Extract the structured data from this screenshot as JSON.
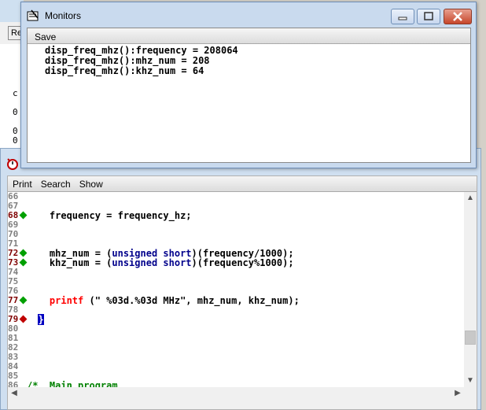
{
  "monitors": {
    "title": "Monitors",
    "save_label": "Save",
    "lines": [
      "disp_freq_mhz():frequency = 208064",
      "disp_freq_mhz():mhz_num = 208",
      "disp_freq_mhz():khz_num = 64"
    ]
  },
  "background_window": {
    "tab_label": "Re",
    "fragments": [
      "c",
      "0",
      "0",
      "0"
    ]
  },
  "editor": {
    "menu": [
      "Print",
      "Search",
      "Show"
    ],
    "lines": [
      {
        "n": "66",
        "code": ""
      },
      {
        "n": "67",
        "code": ""
      },
      {
        "n": "68",
        "code": "    frequency = frequency_hz;"
      },
      {
        "n": "69",
        "code": ""
      },
      {
        "n": "70",
        "code": ""
      },
      {
        "n": "71",
        "code": ""
      },
      {
        "n": "72",
        "pre": "    mhz_num = (",
        "kw": "unsigned short",
        "post": ")(frequency/1000);"
      },
      {
        "n": "73",
        "pre": "    khz_num = (",
        "kw": "unsigned short",
        "post": ")(frequency%1000);"
      },
      {
        "n": "74",
        "code": ""
      },
      {
        "n": "75",
        "code": ""
      },
      {
        "n": "76",
        "code": ""
      },
      {
        "n": "77",
        "fn": "printf",
        "post": " (\" %03d.%03d MHz\", mhz_num, khz_num);"
      },
      {
        "n": "78",
        "code": ""
      },
      {
        "n": "79",
        "sel": "}"
      },
      {
        "n": "80",
        "code": ""
      },
      {
        "n": "81",
        "code": ""
      },
      {
        "n": "82",
        "code": ""
      },
      {
        "n": "83",
        "code": ""
      },
      {
        "n": "84",
        "code": ""
      },
      {
        "n": "85",
        "code": ""
      },
      {
        "n": "86",
        "cm": "/*  Main program"
      }
    ]
  },
  "colors": {
    "keyword": "#00008b",
    "function": "#ff0000",
    "breakpoint_green": "#00a000",
    "breakpoint_red": "#c00000",
    "selection": "#0000c0"
  }
}
